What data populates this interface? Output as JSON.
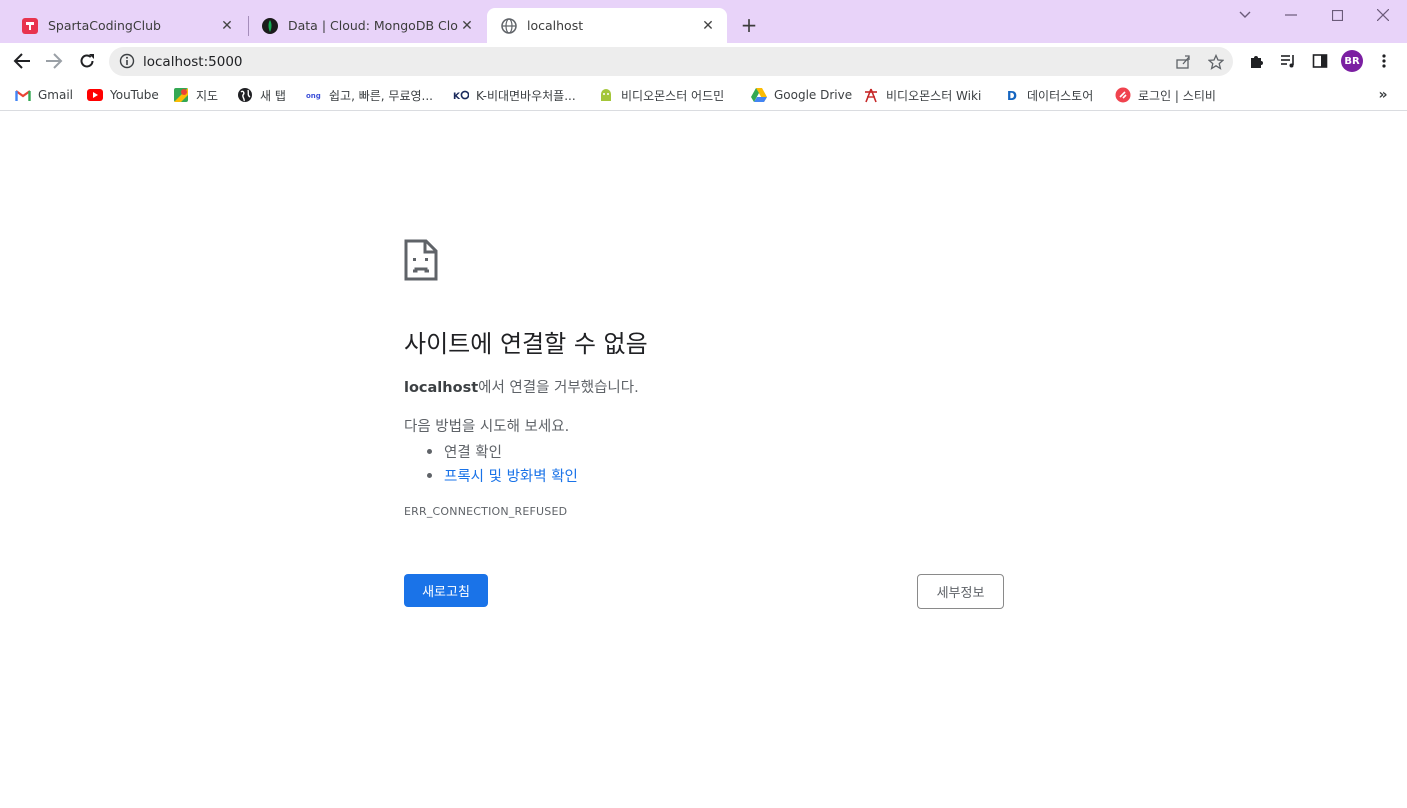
{
  "tabs": [
    {
      "title": "SpartaCodingClub",
      "icon": "sparta-logo-icon",
      "active": false
    },
    {
      "title": "Data | Cloud: MongoDB Cloud",
      "icon": "mongodb-leaf-icon",
      "active": false
    },
    {
      "title": "localhost",
      "icon": "globe-icon",
      "active": true
    }
  ],
  "toolbar": {
    "url": "localhost:5000",
    "profile_initials": "BR"
  },
  "bookmarks": [
    {
      "label": "Gmail",
      "icon": "gmail-icon"
    },
    {
      "label": "YouTube",
      "icon": "youtube-icon"
    },
    {
      "label": "지도",
      "icon": "maps-icon"
    },
    {
      "label": "새 탭",
      "icon": "globe-icon"
    },
    {
      "label": "쉽고, 빠른, 무료영...",
      "icon": "ong-icon"
    },
    {
      "label": "K-비대면바우처플...",
      "icon": "kvoucher-icon"
    },
    {
      "label": "비디오몬스터 어드민",
      "icon": "android-icon"
    },
    {
      "label": "Google Drive",
      "icon": "google-drive-icon"
    },
    {
      "label": "비디오몬스터 Wiki",
      "icon": "wiki-icon"
    },
    {
      "label": "데이터스토어",
      "icon": "datastore-icon"
    },
    {
      "label": "로그인 | 스티비",
      "icon": "stibee-icon"
    }
  ],
  "error": {
    "title": "사이트에 연결할 수 없음",
    "host": "localhost",
    "desc_suffix": "에서 연결을 거부했습니다.",
    "try_label": "다음 방법을 시도해 보세요.",
    "suggestion_check": "연결 확인",
    "suggestion_proxy": "프록시 및 방화벽 확인",
    "code": "ERR_CONNECTION_REFUSED",
    "reload_label": "새로고침",
    "details_label": "세부정보"
  },
  "colors": {
    "tabstrip": "#e8d3f9",
    "accent": "#1a73e8",
    "avatar": "#7b1fa2"
  }
}
